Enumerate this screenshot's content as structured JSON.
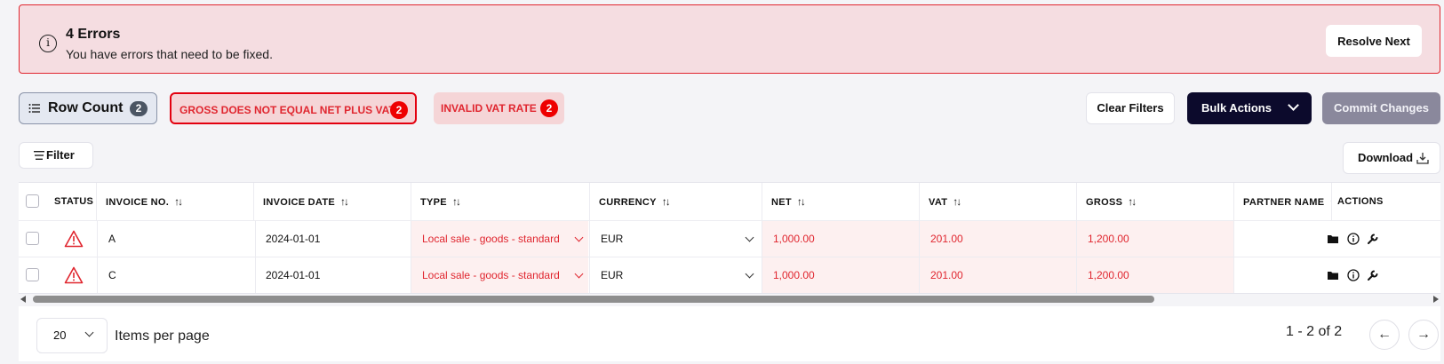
{
  "alert": {
    "title": "4 Errors",
    "message": "You have errors that need to be fixed.",
    "resolve_label": "Resolve Next",
    "info_glyph": "i"
  },
  "toolbar": {
    "row_count_label": "Row Count",
    "row_count_badge": "2",
    "chips": [
      {
        "label": "GROSS DOES NOT EQUAL NET PLUS VAT",
        "count": "2",
        "active": true
      },
      {
        "label": "INVALID VAT RATE",
        "count": "2",
        "active": false
      }
    ],
    "clear_filters_label": "Clear Filters",
    "bulk_actions_label": "Bulk Actions",
    "commit_label": "Commit Changes",
    "filter_label": "Filter",
    "download_label": "Download"
  },
  "table": {
    "headers": [
      "STATUS",
      "INVOICE NO.",
      "INVOICE DATE",
      "TYPE",
      "CURRENCY",
      "NET",
      "VAT",
      "GROSS",
      "PARTNER NAME",
      "ACTIONS"
    ],
    "sort_glyph": "↑↓",
    "rows": [
      {
        "status": "warning",
        "invoice_no": "A",
        "invoice_date": "2024-01-01",
        "type": "Local sale - goods - standard",
        "currency": "EUR",
        "net": "1,000.00",
        "vat": "201.00",
        "gross": "1,200.00",
        "partner": ""
      },
      {
        "status": "warning",
        "invoice_no": "C",
        "invoice_date": "2024-01-01",
        "type": "Local sale - goods - standard",
        "currency": "EUR",
        "net": "1,000.00",
        "vat": "201.00",
        "gross": "1,200.00",
        "partner": ""
      }
    ]
  },
  "pagination": {
    "per_page": "20",
    "items_per_page_label": "Items per page",
    "range": "1 - 2 of 2",
    "prev_glyph": "←",
    "next_glyph": "→"
  },
  "colors": {
    "error": "#e0262f",
    "alert_bg": "#f5dde1",
    "primary_dark": "#0c0a2c",
    "commit_disabled": "#8a889c"
  }
}
